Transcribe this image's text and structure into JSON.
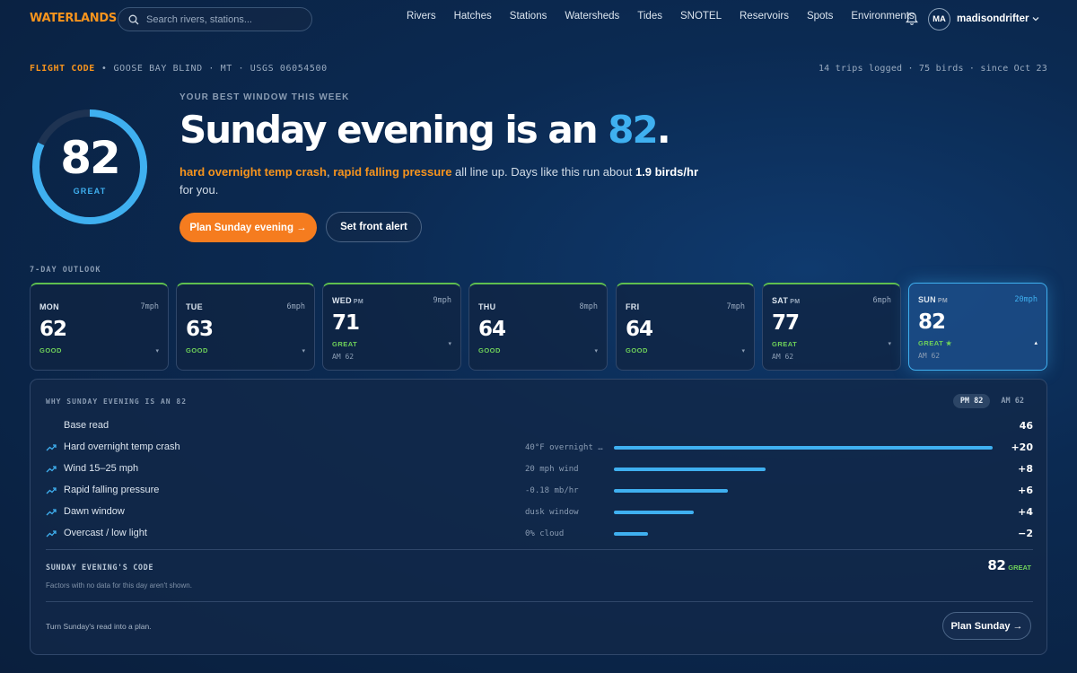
{
  "app": {
    "logo": "WATERLANDS"
  },
  "search": {
    "placeholder": "Search rivers, stations..."
  },
  "nav": [
    "Rivers",
    "Hatches",
    "Stations",
    "Watersheds",
    "Tides",
    "SNOTEL",
    "Reservoirs",
    "Spots",
    "Environments"
  ],
  "user": {
    "initials": "MA",
    "name": "madisondrifter"
  },
  "location": {
    "code_label": "FLIGHT CODE",
    "sep": "•",
    "name": "GOOSE BAY BLIND · MT · USGS 06054500"
  },
  "stats": "14 trips logged · 75 birds · since Oct 23",
  "gauge": {
    "value": "82",
    "label": "GREAT",
    "fraction": 0.82
  },
  "hero": {
    "eyebrow": "YOUR BEST WINDOW THIS WEEK",
    "headline_prefix": "Sunday evening is an ",
    "headline_score": "82",
    "headline_suffix": ".",
    "factor1": "hard overnight temp crash",
    "comma": ",",
    "factor2": "rapid falling pressure",
    "text_mid": " all line up. Days like this run about ",
    "rate": "1.9 birds/hr",
    "text_end": " for you.",
    "primary_button": "Plan Sunday evening →",
    "secondary_button": "Set front alert"
  },
  "outlook": {
    "label": "7-DAY OUTLOOK",
    "days": [
      {
        "name": "MON",
        "period": "",
        "wind": "7mph",
        "score": "62",
        "rating": "GOOD",
        "am": ""
      },
      {
        "name": "TUE",
        "period": "",
        "wind": "6mph",
        "score": "63",
        "rating": "GOOD",
        "am": ""
      },
      {
        "name": "WED",
        "period": "PM",
        "wind": "9mph",
        "score": "71",
        "rating": "GREAT",
        "am": "AM 62"
      },
      {
        "name": "THU",
        "period": "",
        "wind": "8mph",
        "score": "64",
        "rating": "GOOD",
        "am": ""
      },
      {
        "name": "FRI",
        "period": "",
        "wind": "7mph",
        "score": "64",
        "rating": "GOOD",
        "am": ""
      },
      {
        "name": "SAT",
        "period": "PM",
        "wind": "6mph",
        "score": "77",
        "rating": "GREAT",
        "am": "AM 62"
      },
      {
        "name": "SUN",
        "period": "PM",
        "wind": "20mph",
        "score": "82",
        "rating": "GREAT ★",
        "am": "AM 62"
      }
    ]
  },
  "breakdown": {
    "title": "WHY SUNDAY EVENING IS AN 82",
    "toggle_pm": "PM 82",
    "toggle_am": "AM 62",
    "factors": [
      {
        "name": "Base read",
        "detail": "",
        "value": "46",
        "fraction": 0
      },
      {
        "name": "Hard overnight temp crash",
        "detail": "40°F overnight …",
        "value": "+20",
        "fraction": 1.0
      },
      {
        "name": "Wind 15–25 mph",
        "detail": "20 mph wind",
        "value": "+8",
        "fraction": 0.4
      },
      {
        "name": "Rapid falling pressure",
        "detail": "-0.18 mb/hr",
        "value": "+6",
        "fraction": 0.3
      },
      {
        "name": "Dawn window",
        "detail": "dusk window",
        "value": "+4",
        "fraction": 0.21
      },
      {
        "name": "Overcast / low light",
        "detail": "0% cloud",
        "value": "−2",
        "fraction": 0.09
      }
    ],
    "code_title": "SUNDAY EVENING'S CODE",
    "code_note": "Factors with no data for this day aren't shown.",
    "code_score": "82",
    "code_rating": "GREAT",
    "plan_note": "Turn Sunday's read into a plan.",
    "plan_button": "Plan Sunday →"
  },
  "colors": {
    "accent": "#3fb0f0",
    "brand": "#f7941d",
    "good": "#6fd15a",
    "bg": "#0b2a52"
  }
}
